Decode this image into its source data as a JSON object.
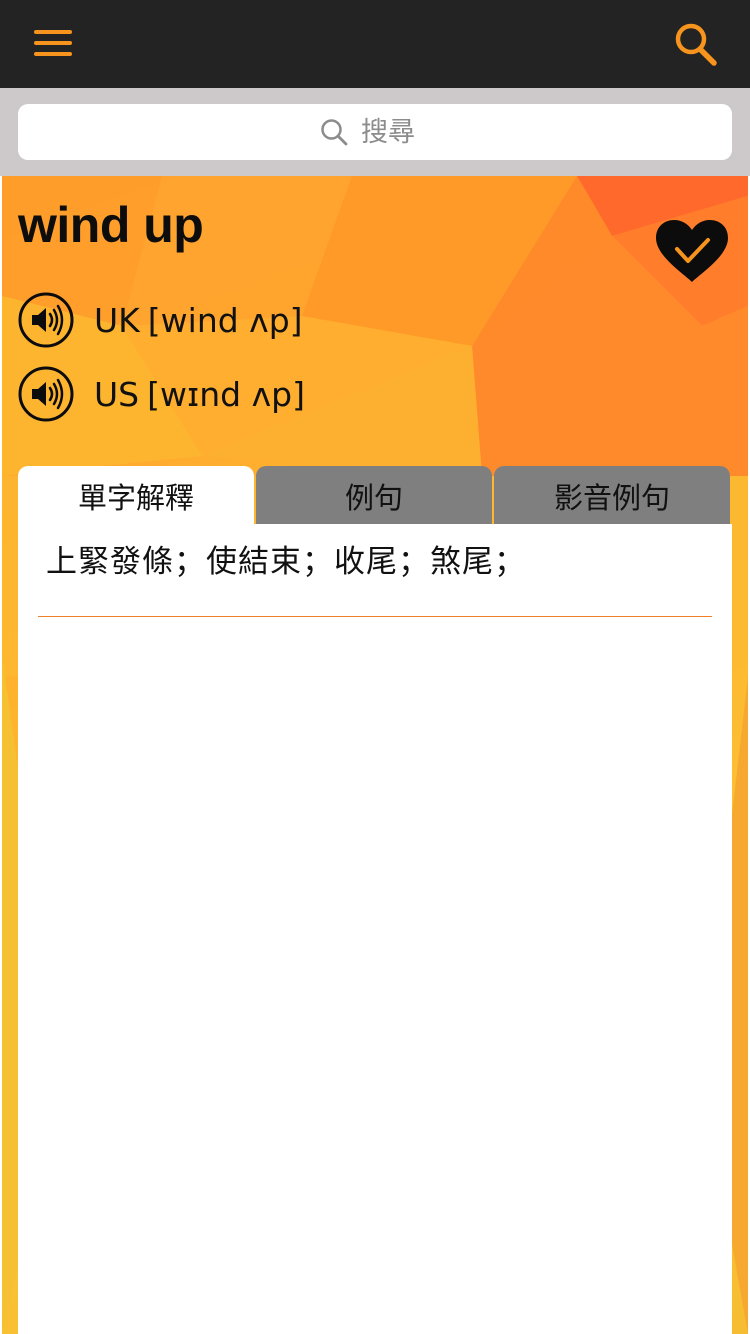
{
  "topbar": {
    "menu_icon": "hamburger-menu-icon",
    "search_icon": "search-icon",
    "icon_color": "#f7941d"
  },
  "search": {
    "placeholder": "搜尋",
    "icon": "search-icon"
  },
  "entry": {
    "word": "wind up",
    "favorite_icon": "heart-check-icon",
    "pronunciations": [
      {
        "region": "UK",
        "ipa": "[wind ʌp]",
        "icon": "speaker-icon"
      },
      {
        "region": "US",
        "ipa": "[wɪnd ʌp]",
        "icon": "speaker-icon"
      }
    ]
  },
  "tabs": [
    {
      "label": "單字解釋",
      "active": true
    },
    {
      "label": "例句",
      "active": false
    },
    {
      "label": "影音例句",
      "active": false
    }
  ],
  "definition": {
    "text": "上緊發條；使結束；收尾；煞尾；"
  },
  "colors": {
    "topbar": "#232323",
    "search_strip": "#cdc8c9",
    "accent": "#f7941d",
    "tab_inactive": "#7f7f7f",
    "divider": "#f0802c"
  }
}
